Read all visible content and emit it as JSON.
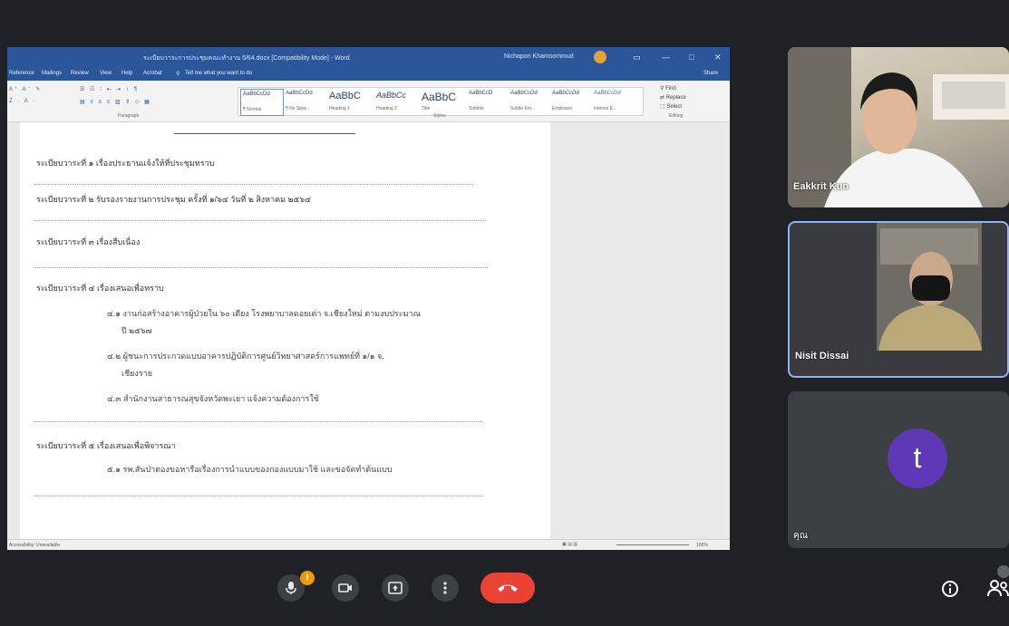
{
  "word": {
    "title": "ระเบียบวาระการประชุมคณะทำงาน 5/64.docx [Compatibility Mode] - Word",
    "user": "Nichapon Khamsommud",
    "menu": [
      "Reference",
      "Mailings",
      "Review",
      "View",
      "Help",
      "Acrobat",
      "Tell me what you want to do"
    ],
    "share_label": "Share",
    "ribbon_groups": {
      "paragraph": "Paragraph",
      "styles": "Styles",
      "editing": "Editing"
    },
    "styles": [
      {
        "preview": "AaBbCcDd",
        "name": "¶ Normal"
      },
      {
        "preview": "AaBbCcDd",
        "name": "¶ No Spac..."
      },
      {
        "preview": "AaBbC",
        "name": "Heading 1"
      },
      {
        "preview": "AaBbCc",
        "name": "Heading 2"
      },
      {
        "preview": "AaBbC",
        "name": "Title"
      },
      {
        "preview": "AaBbCcD",
        "name": "Subtitle"
      },
      {
        "preview": "AaBbCcDd",
        "name": "Subtle Em..."
      },
      {
        "preview": "AaBbCcDd",
        "name": "Emphasis"
      },
      {
        "preview": "AaBbCcDd",
        "name": "Intense E..."
      }
    ],
    "editing": {
      "find": "Find",
      "replace": "Replace",
      "select": "Select"
    },
    "status_left": "Accessibility: Unavailable",
    "zoom": "100%",
    "doc": {
      "agenda1": "ระเบียบวาระที่ ๑ เรื่องประธานแจ้งให้ที่ประชุมทราบ",
      "agenda2": "ระเบียบวาระที่ ๒ รับรองรายงานการประชุม ครั้งที่ ๑/๖๔ วันที่ ๒ สิงหาคม ๒๕๖๔",
      "agenda3": "ระเบียบวาระที่ ๓ เรื่องสืบเนื่อง",
      "agenda4": "ระเบียบวาระที่ ๔ เรื่องเสนอเพื่อทราบ",
      "item41a": "๔.๑ งานก่อสร้างอาคารผู้ป่วยใน ๖๐ เตียง โรงพยาบาลดอยเต่า จ.เชียงใหม่ ตามงบประมาณ",
      "item41b": "ปี ๒๕๖๗",
      "item42a": "๔.๒ ผู้ชนะการประกวดแบบอาคารปฏิบัติการศูนย์วิทยาศาสตร์การแพทย์ที่ ๑/๑ จ.",
      "item42b": "เชียงราย",
      "item43": "๔.๓ สำนักงานสาธารณสุขจังหวัดพะเยา แจ้งความต้องการใช้",
      "agenda5": "ระเบียบวาระที่ ๕ เรื่องเสนอเพื่อพิจารณา",
      "item51": "๕.๑ รพ.สันป่าตองขอหารือเรื่องการนำแบบของกองแบบมาใช้ และขอจัดทำต้นแบบ"
    }
  },
  "participants": [
    {
      "name": "Eakkrit Kun"
    },
    {
      "name": "Nisit Dissai"
    },
    {
      "name": "คุณ",
      "initial": "t",
      "avatar_color": "#5d39b7"
    }
  ],
  "controls": {
    "mic_badge": "!",
    "end_color": "#ea4335",
    "accent": "#8ab4f8"
  }
}
